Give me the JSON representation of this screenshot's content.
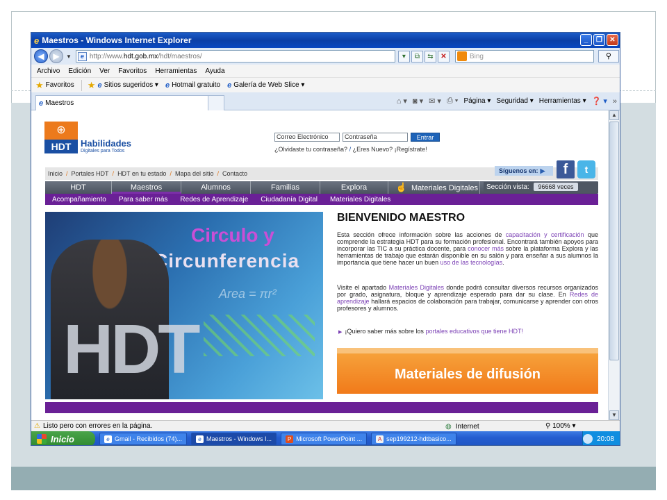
{
  "window": {
    "title": "Maestros - Windows Internet Explorer",
    "minimize": "_",
    "restore": "❐",
    "close": "✕"
  },
  "address": {
    "url_prefix": "http://www.",
    "url_domain": "hdt.gob.mx",
    "url_path": "/hdt/maestros/",
    "search_placeholder": "Bing"
  },
  "menu": [
    "Archivo",
    "Edición",
    "Ver",
    "Favoritos",
    "Herramientas",
    "Ayuda"
  ],
  "favorites_bar": {
    "favorites": "Favoritos",
    "items": [
      "Sitios sugeridos ▾",
      "Hotmail gratuito",
      "Galería de Web Slice ▾"
    ]
  },
  "tab": {
    "label": "Maestros"
  },
  "command_bar": [
    "Página ▾",
    "Seguridad ▾",
    "Herramientas ▾"
  ],
  "site": {
    "logo": {
      "badge": "HDT",
      "name": "Habilidades",
      "sub": "Digitales para Todos"
    },
    "login": {
      "email_value": "Correo Electrónico",
      "password_value": "Contraseña",
      "button": "Entrar",
      "forgot": "¿Olvidaste tu contraseña?",
      "slash": "/",
      "new_register": "¿Eres Nuevo? ¡Regístrate!"
    },
    "breadcrumb": [
      "Inicio",
      "Portales HDT",
      "HDT en tu estado",
      "Mapa del sitio",
      "Contacto"
    ],
    "follow": "Síguenos en:",
    "facebook": "f",
    "twitter": "t",
    "nav": [
      "HDT",
      "Maestros",
      "Alumnos",
      "Familias",
      "Explora",
      "Materiales Digitales"
    ],
    "visits_label": "Sección vista:",
    "visits_count": "96668 veces",
    "subnav": [
      "Acompañamiento",
      "Para saber más",
      "Redes de Aprendizaje",
      "Ciudadanía Digital",
      "Materiales Digitales"
    ],
    "hero": {
      "title_line1": "Circulo y",
      "title_line2": "Circunferencia",
      "formula": "Area = πr²",
      "watermark": "HDT"
    },
    "welcome": {
      "title": "BIENVENIDO MAESTRO",
      "p1_a": "Esta sección ofrece información sobre las acciones de ",
      "p1_link1": "capacitación y certificación",
      "p1_b": " que comprende la estrategia HDT para su formación profesional. Encontrará también apoyos para incorporar las TIC a su práctica docente, para ",
      "p1_link2": "conocer más",
      "p1_c": " sobre la plataforma Explora y las herramientas de trabajo que estarán disponible en su salón y para enseñar a sus alumnos la importancia que tiene hacer un buen ",
      "p1_link3": "uso de las tecnologías",
      "p1_d": ".",
      "p2_a": "Visite el apartado ",
      "p2_link1": "Materiales Digitales",
      "p2_b": " donde podrá consultar diversos recursos organizados por grado, asignatura, bloque y aprendizaje esperado para dar su clase. En ",
      "p2_link2": "Redes de aprendizaje",
      "p2_c": " hallará espacios de colaboración para trabajar, comunicarse y aprender con otros profesores y alumnos.",
      "more_a": "¡Quiero saber más sobre los ",
      "more_link": "portales educativos que tiene HDT!",
      "banner": "Materiales de difusión"
    }
  },
  "status": {
    "text": "Listo pero con errores en la página.",
    "zone": "Internet",
    "zoom": "100%"
  },
  "taskbar": {
    "start": "Inicio",
    "tasks": [
      "Gmail - Recibidos (74)...",
      "Maestros - Windows I...",
      "Microsoft PowerPoint ...",
      "sep199212-hdtbasico..."
    ],
    "clock": "20:08"
  },
  "colors": {
    "purple": "#6a2096",
    "orange": "#f17a1a",
    "hdt_blue": "#1a4fa3",
    "nav_gray": "#4b5360"
  }
}
